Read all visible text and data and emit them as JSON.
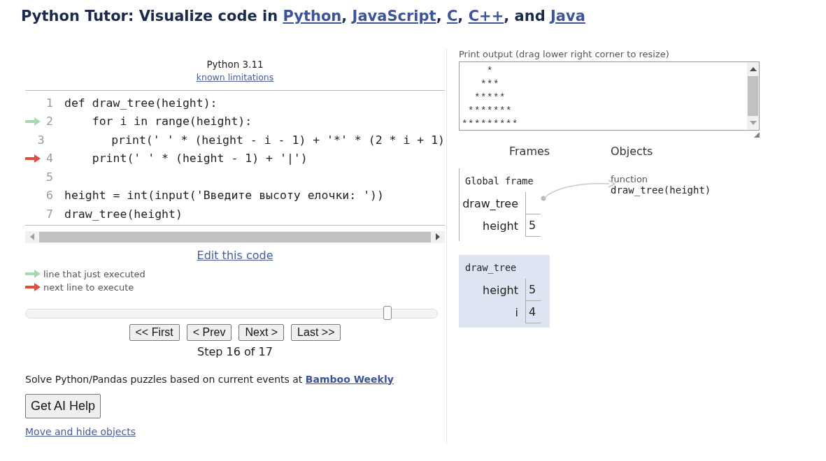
{
  "heading": [
    {
      "kind": "text",
      "text": "Python Tutor: Visualize code in "
    },
    {
      "kind": "link",
      "text": "Python"
    },
    {
      "kind": "text",
      "text": ", "
    },
    {
      "kind": "link",
      "text": "JavaScript"
    },
    {
      "kind": "text",
      "text": ", "
    },
    {
      "kind": "link",
      "text": "C"
    },
    {
      "kind": "text",
      "text": ", "
    },
    {
      "kind": "link",
      "text": "C++"
    },
    {
      "kind": "text",
      "text": ", and "
    },
    {
      "kind": "link",
      "text": "Java"
    }
  ],
  "editor": {
    "language": "Python 3.11",
    "limitations_link": "known limitations",
    "lines": [
      {
        "number": "1",
        "code": "def draw_tree(height):",
        "executed": false,
        "next": false
      },
      {
        "number": "2",
        "code": "    for i in range(height):",
        "executed": true,
        "next": false
      },
      {
        "number": "3",
        "code": "        print(' ' * (height - i - 1) + '*' * (2 * i + 1)",
        "executed": false,
        "next": false
      },
      {
        "number": "4",
        "code": "    print(' ' * (height - 1) + '|')",
        "executed": false,
        "next": true
      },
      {
        "number": "5",
        "executed": false,
        "next": false
      },
      {
        "number": "6",
        "code": "height = int(input('Введите высоту елочки: '))",
        "executed": false,
        "next": false
      },
      {
        "number": "7",
        "code": "draw_tree(height)",
        "executed": false,
        "next": false
      }
    ]
  },
  "edit_link": "Edit this code",
  "legend": [
    {
      "kind": "executed",
      "text": "line that just executed"
    },
    {
      "kind": "next",
      "text": "next line to execute"
    }
  ],
  "step_slider": {
    "level": 0.88
  },
  "nav_buttons": [
    "<< First",
    "< Prev",
    "Next >",
    "Last >>"
  ],
  "step_text": "Step 16 of 17",
  "promo": {
    "text": "Solve Python/Pandas puzzles based on current events at ",
    "link": "Bamboo Weekly"
  },
  "ai_button": "Get AI Help",
  "move_link": "Move and hide objects",
  "print_output": {
    "label": "Print output (drag lower right corner to resize)",
    "text": "    *\n   ***\n  *****\n *******\n*********"
  },
  "frames_heading": "Frames",
  "objects_heading": "Objects",
  "frames": [
    {
      "name": "Global frame",
      "selected": false,
      "variables": [
        {
          "name": "draw_tree",
          "kind": "pointer"
        },
        {
          "name": "height",
          "kind": "value",
          "value": "5"
        }
      ]
    },
    {
      "name": "draw_tree",
      "selected": true,
      "variables": [
        {
          "name": "height",
          "kind": "value",
          "value": "5"
        },
        {
          "name": "i",
          "kind": "value",
          "value": "4"
        }
      ]
    }
  ],
  "objects": [
    {
      "type": "function",
      "signature": "draw_tree(height)"
    }
  ]
}
